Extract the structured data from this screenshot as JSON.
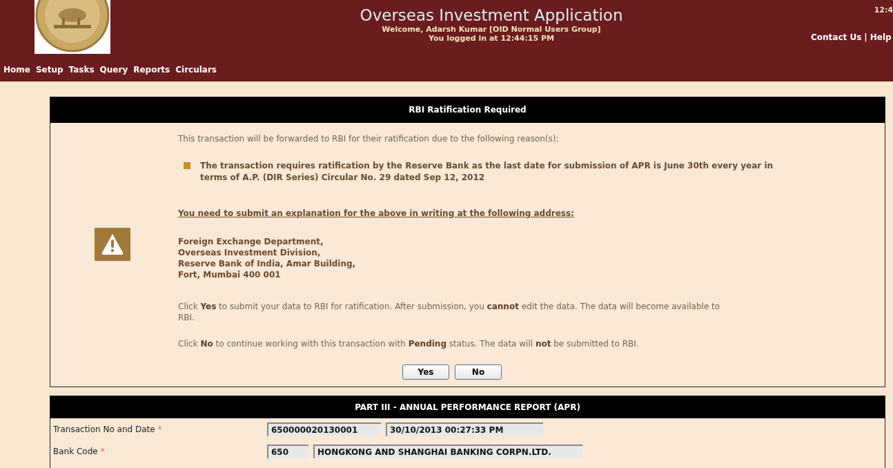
{
  "header": {
    "title": "Overseas Investment Application",
    "welcome": "Welcome, Adarsh Kumar [OID Normal Users Group]",
    "login_time": "You logged in at 12:44:15 PM",
    "clock": "12:4",
    "links": [
      {
        "label": "Contact Us"
      },
      {
        "label": "Help"
      }
    ],
    "separator": "|"
  },
  "menu": [
    "Home",
    "Setup",
    "Tasks",
    "Query",
    "Reports",
    "Circulars"
  ],
  "dialog": {
    "title": "RBI Ratification Required",
    "intro": "This transaction will be forwarded to RBI for their ratification due to the following reason(s):",
    "reasons": [
      "The transaction requires ratification by the Reserve Bank as the last date for submission of APR is June 30th every year in terms of A.P. (DIR Series) Circular No. 29 dated Sep 12, 2012"
    ],
    "explanation_heading": "You need to submit an explanation for the above in writing at the following address:",
    "address": [
      "Foreign Exchange Department,",
      "Overseas Investment Division,",
      "Reserve Bank of India, Amar Building,",
      "Fort, Mumbai 400 001"
    ],
    "notes": [
      "Click **Yes** to submit your data to RBI for ratification. After submission, you **cannot** edit the data. The data will become available to RBI.",
      "Click **No** to continue working with this transaction with **Pending** status. The data will **not** be submitted to RBI."
    ],
    "buttons": [
      "Yes",
      "No"
    ]
  },
  "form": {
    "title": "PART III - ANNUAL PERFORMANCE REPORT (APR)",
    "rows": [
      {
        "label": "Transaction No and Date",
        "required_mark": "*",
        "fields": [
          "650000020130001",
          "30/10/2013 00:27:33 PM"
        ]
      },
      {
        "label": "Bank Code",
        "required_mark": "*",
        "fields": [
          "650",
          "HONGKONG AND SHANGHAI BANKING CORPN.LTD."
        ]
      }
    ]
  }
}
